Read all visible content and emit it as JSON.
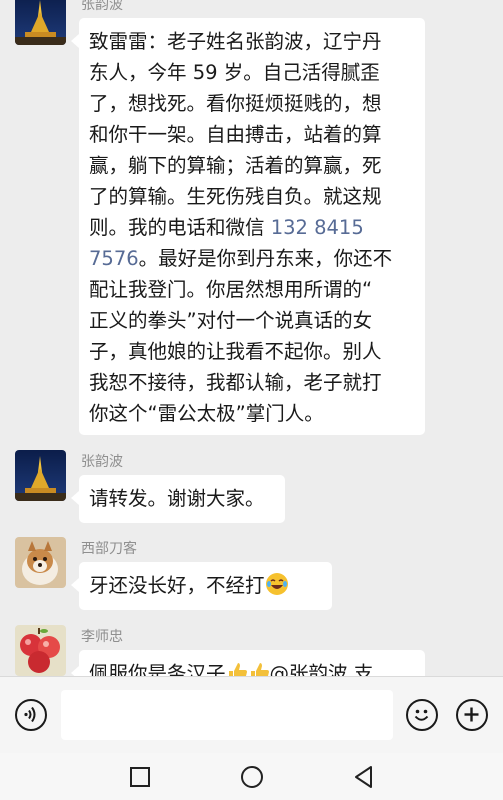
{
  "messages": [
    {
      "sender": "张韵波",
      "avatar": "pagoda-night-avatar",
      "lines": [
        "致雷雷：老子姓名张韵波，辽宁丹",
        "东人，今年 59 岁。自己活得腻歪",
        "了，想找死。看你挺烦挺贱的，想",
        "和你干一架。自由搏击，站着的算",
        "赢，躺下的算输；活着的算赢，死",
        "了的算输。生死伤残自负。就这规",
        "则。我的电话和微信 ",
        "7576",
        "。最好是你到丹东来，你还不",
        "配让我登门。你居然想用所谓的“",
        "正义的拳头”对付一个说真话的女",
        "子，真他娘的让我看不起你。别人",
        "我恕不接待，我都认输，老子就打",
        "你这个“雷公太极”掌门人。"
      ],
      "phone_part1": "132 8415",
      "phone_part2": "7576"
    },
    {
      "sender": "张韵波",
      "avatar": "pagoda-night-avatar",
      "text": "请转发。谢谢大家。"
    },
    {
      "sender": "西部刀客",
      "avatar": "dog-avatar",
      "text": "牙还没长好，不经打",
      "emoji": "laughing-tears-emoji"
    },
    {
      "sender": "李师忠",
      "avatar": "apples-avatar",
      "text": "佩服你是条汉子",
      "mention": "@张韵波",
      "tail": " 支"
    }
  ],
  "input_bar": {
    "voice_icon": "voice-icon",
    "emoji_icon": "smiley-icon",
    "plus_icon": "plus-icon"
  },
  "nav": {
    "recents": "square-icon",
    "home": "circle-icon",
    "back": "triangle-back-icon"
  }
}
